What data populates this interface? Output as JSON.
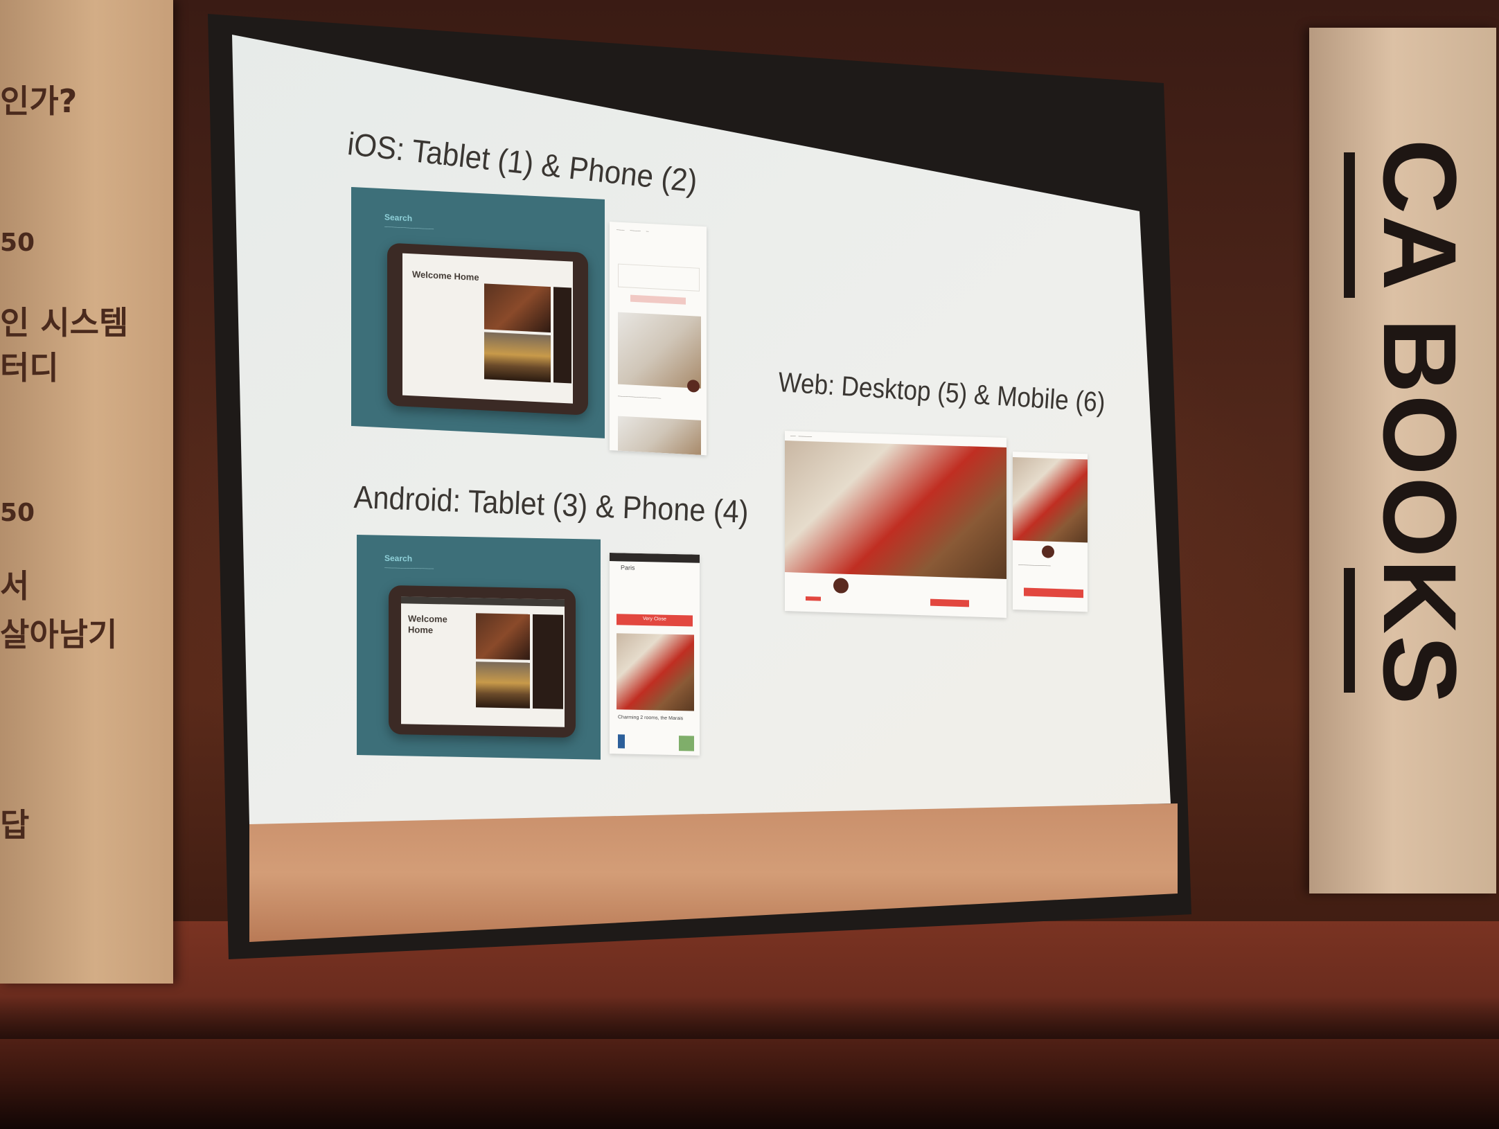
{
  "left_banner": {
    "lines": [
      "인가?",
      "50",
      "인 시스템",
      "터디",
      "50",
      "서",
      "살아남기",
      "답"
    ]
  },
  "right_banner": {
    "brand": "CA BOOKS"
  },
  "slide": {
    "ios_title": "iOS: Tablet (1) & Phone (2)",
    "android_title": "Android: Tablet (3) & Phone (4)",
    "web_title": "Web: Desktop (5) & Mobile (6)",
    "ios_tablet": {
      "label": "Search",
      "welcome": "Welcome Home"
    },
    "android_tablet": {
      "label": "Search",
      "welcome_line1": "Welcome",
      "welcome_line2": "Home"
    },
    "android_phone": {
      "city": "Paris",
      "button": "Very Close",
      "listing": "Charming 2 rooms, the Marais"
    }
  },
  "colors": {
    "slide_bg": "#eaecea",
    "tablet_bg": "#3d6f79",
    "accent_red": "#e2473f",
    "brand_text": "#1e1613"
  }
}
